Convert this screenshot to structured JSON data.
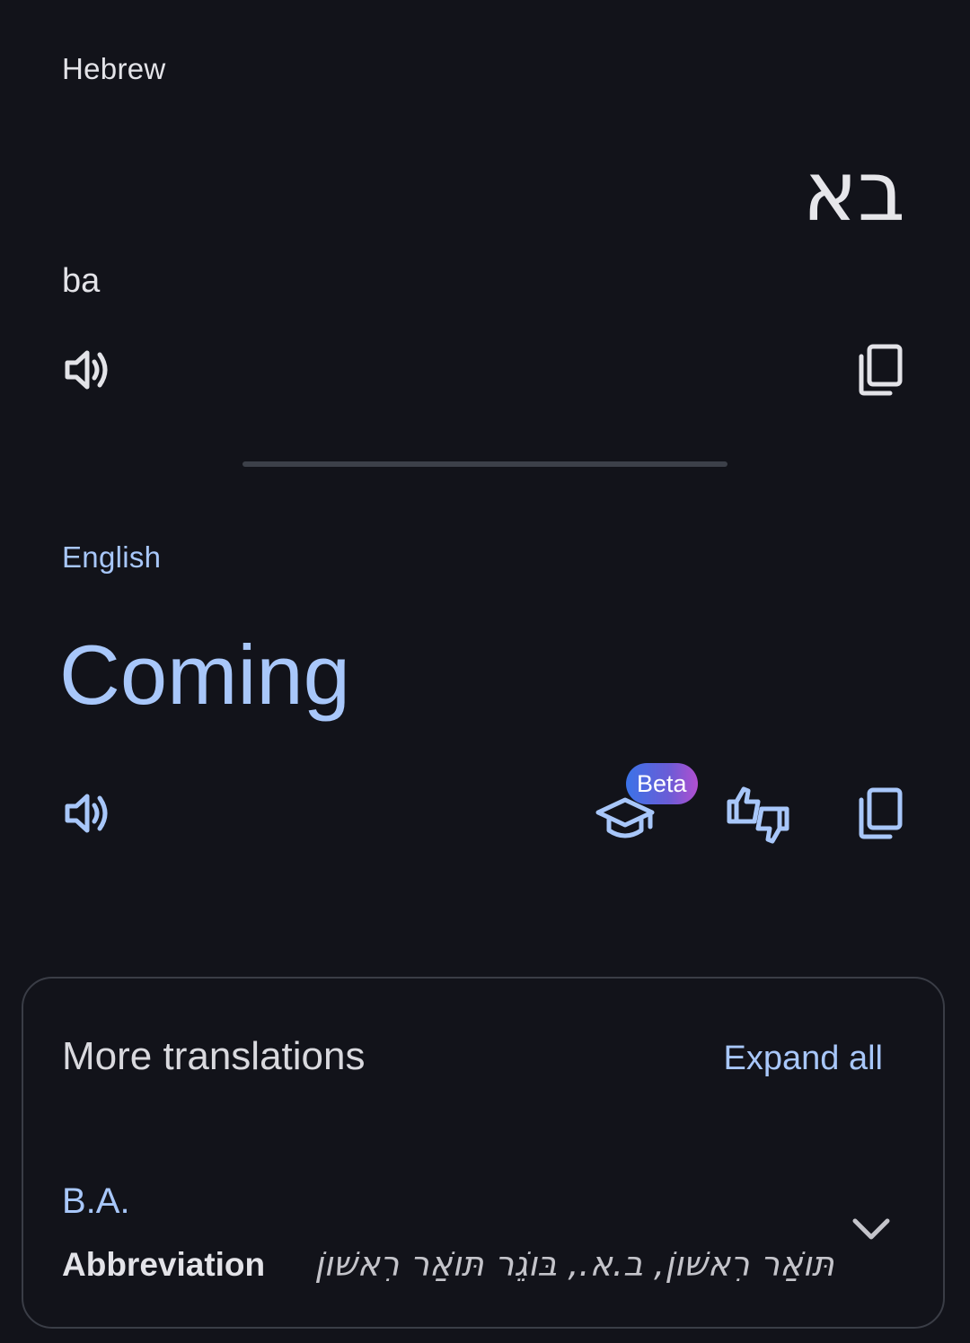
{
  "source": {
    "language": "Hebrew",
    "text": "בא",
    "transliteration": "ba",
    "icons": {
      "listen": "speaker-icon",
      "copy": "copy-icon"
    }
  },
  "target": {
    "language": "English",
    "text": "Coming",
    "icons": {
      "listen": "speaker-icon",
      "learn": "graduation-cap-icon",
      "feedback": "thumbs-feedback-icon",
      "copy": "copy-icon"
    },
    "beta_label": "Beta"
  },
  "more_translations": {
    "title": "More translations",
    "expand_label": "Expand all",
    "entries": [
      {
        "word": "B.A.",
        "part_of_speech": "Abbreviation",
        "synonyms": "תּוֹאַר רִאשׁוֹן, ב.א., בּוֹגֵר תּוֹאַר רִאשׁוֹן"
      }
    ]
  },
  "colors": {
    "background": "#12131a",
    "accent": "#a8c7fa",
    "text": "#e3e3e8",
    "divider": "#3c4049"
  }
}
